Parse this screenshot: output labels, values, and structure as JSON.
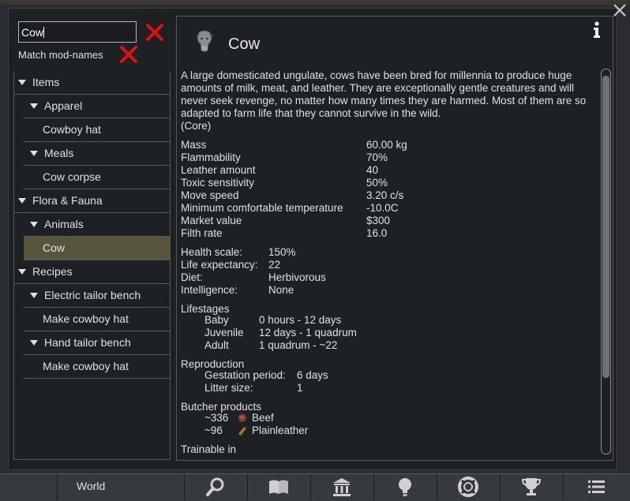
{
  "search": {
    "value": "Cow"
  },
  "match_mod_names_label": "Match mod-names",
  "tree": [
    {
      "label": "Items",
      "level": 0,
      "expanded": true
    },
    {
      "label": "Apparel",
      "level": 1,
      "expanded": true
    },
    {
      "label": "Cowboy hat",
      "level": 2
    },
    {
      "label": "Meals",
      "level": 1,
      "expanded": true
    },
    {
      "label": "Cow corpse",
      "level": 2
    },
    {
      "label": "Flora & Fauna",
      "level": 0,
      "expanded": true
    },
    {
      "label": "Animals",
      "level": 1,
      "expanded": true
    },
    {
      "label": "Cow",
      "level": 2,
      "selected": true
    },
    {
      "label": "Recipes",
      "level": 0,
      "expanded": true
    },
    {
      "label": "Electric tailor bench",
      "level": 1,
      "expanded": true
    },
    {
      "label": "Make cowboy hat",
      "level": 2
    },
    {
      "label": "Hand tailor bench",
      "level": 1,
      "expanded": true
    },
    {
      "label": "Make cowboy hat",
      "level": 2
    }
  ],
  "detail": {
    "title": "Cow",
    "description": "A large domesticated ungulate, cows have been bred for millennia to produce huge amounts of milk, meat, and leather. They are exceptionally gentle creatures and will never seek revenge, no matter how many times they are harmed. Most of them are so adapted to farm life that they cannot survive in the wild.",
    "source": "(Core)",
    "stats": [
      {
        "label": "Mass",
        "value": "60.00 kg"
      },
      {
        "label": "Flammability",
        "value": "70%"
      },
      {
        "label": "Leather amount",
        "value": "40"
      },
      {
        "label": "Toxic sensitivity",
        "value": "50%"
      },
      {
        "label": "Move speed",
        "value": "3.20 c/s"
      },
      {
        "label": "Minimum comfortable temperature",
        "value": "-10.0C"
      },
      {
        "label": "Market value",
        "value": "$300"
      },
      {
        "label": "Filth rate",
        "value": "16.0"
      }
    ],
    "race": [
      {
        "label": "Health scale:",
        "value": "150%"
      },
      {
        "label": "Life expectancy:",
        "value": "22"
      },
      {
        "label": "Diet:",
        "value": "Herbivorous"
      },
      {
        "label": "Intelligence:",
        "value": "None"
      }
    ],
    "lifestages_heading": "Lifestages",
    "lifestages": [
      {
        "label": "Baby",
        "value": "0 hours - 12 days"
      },
      {
        "label": "Juvenile",
        "value": "12 days - 1 quadrum"
      },
      {
        "label": "Adult",
        "value": "1 quadrum - ~22"
      }
    ],
    "reproduction_heading": "Reproduction",
    "reproduction": [
      {
        "label": "Gestation period:",
        "value": "6 days"
      },
      {
        "label": "Litter size:",
        "value": "1"
      }
    ],
    "butcher_heading": "Butcher products",
    "butcher": [
      {
        "amount": "~336",
        "name": "Beef",
        "icon": "beef-icon"
      },
      {
        "amount": "~96",
        "name": "Plainleather",
        "icon": "leather-icon"
      }
    ],
    "trainable_heading": "Trainable in"
  },
  "bottom_bar": {
    "world_label": "World"
  },
  "colors": {
    "selected_row": "#57563d",
    "remove_x": "#e01010",
    "panel_bg": "#1e2124"
  }
}
